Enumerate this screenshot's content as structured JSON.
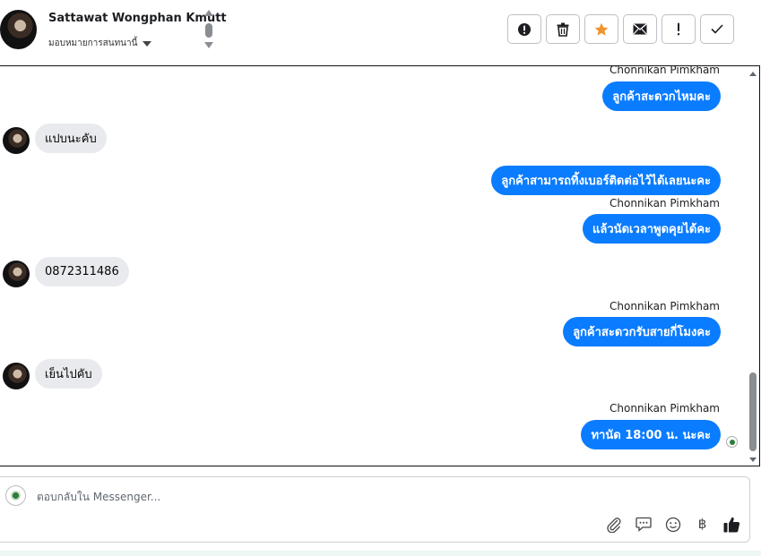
{
  "header": {
    "contact_name": "Sattawat Wongphan Kmutt",
    "assign_label": "มอบหมายการสนทนานี้"
  },
  "toolbar": {
    "buttons": [
      {
        "name": "mark-spam",
        "icon": "alert-circle-icon"
      },
      {
        "name": "delete",
        "icon": "trash-icon"
      },
      {
        "name": "star",
        "icon": "star-icon",
        "color": "#f0932b"
      },
      {
        "name": "mark-unread",
        "icon": "envelope-icon"
      },
      {
        "name": "follow-up",
        "icon": "exclamation-icon"
      },
      {
        "name": "mark-done",
        "icon": "check-icon"
      }
    ]
  },
  "messages": [
    {
      "direction": "out",
      "sender": "Chonnikan Pimkham",
      "text": "ลูกค้าสะดวกไหมคะ"
    },
    {
      "direction": "in",
      "text": "แปบนะคับ"
    },
    {
      "direction": "out",
      "text": "ลูกค้าสามารถทิ้งเบอร์ติดต่อไว้ได้เลยนะคะ"
    },
    {
      "direction": "out",
      "sender": "Chonnikan Pimkham",
      "text": "แล้วนัดเวลาพูดคุยได้คะ"
    },
    {
      "direction": "in",
      "text": "0872311486"
    },
    {
      "direction": "out",
      "sender": "Chonnikan Pimkham",
      "text": "ลูกค้าสะดวกรับสายกี่โมงคะ"
    },
    {
      "direction": "in",
      "text": "เย็นไปคับ"
    },
    {
      "direction": "out",
      "sender": "Chonnikan Pimkham",
      "text": "ทานัด 18:00 น. นะคะ"
    }
  ],
  "composer": {
    "placeholder": "ตอบกลับใน Messenger...",
    "actions": [
      "attachment-icon",
      "saved-reply-icon",
      "emoji-icon",
      "baht-payment-icon",
      "thumbs-up-icon"
    ],
    "baht_symbol": "฿"
  },
  "colors": {
    "outgoing_bubble": "#0a7cff",
    "incoming_bubble": "#e9eaed",
    "accent_star": "#f0932b"
  }
}
